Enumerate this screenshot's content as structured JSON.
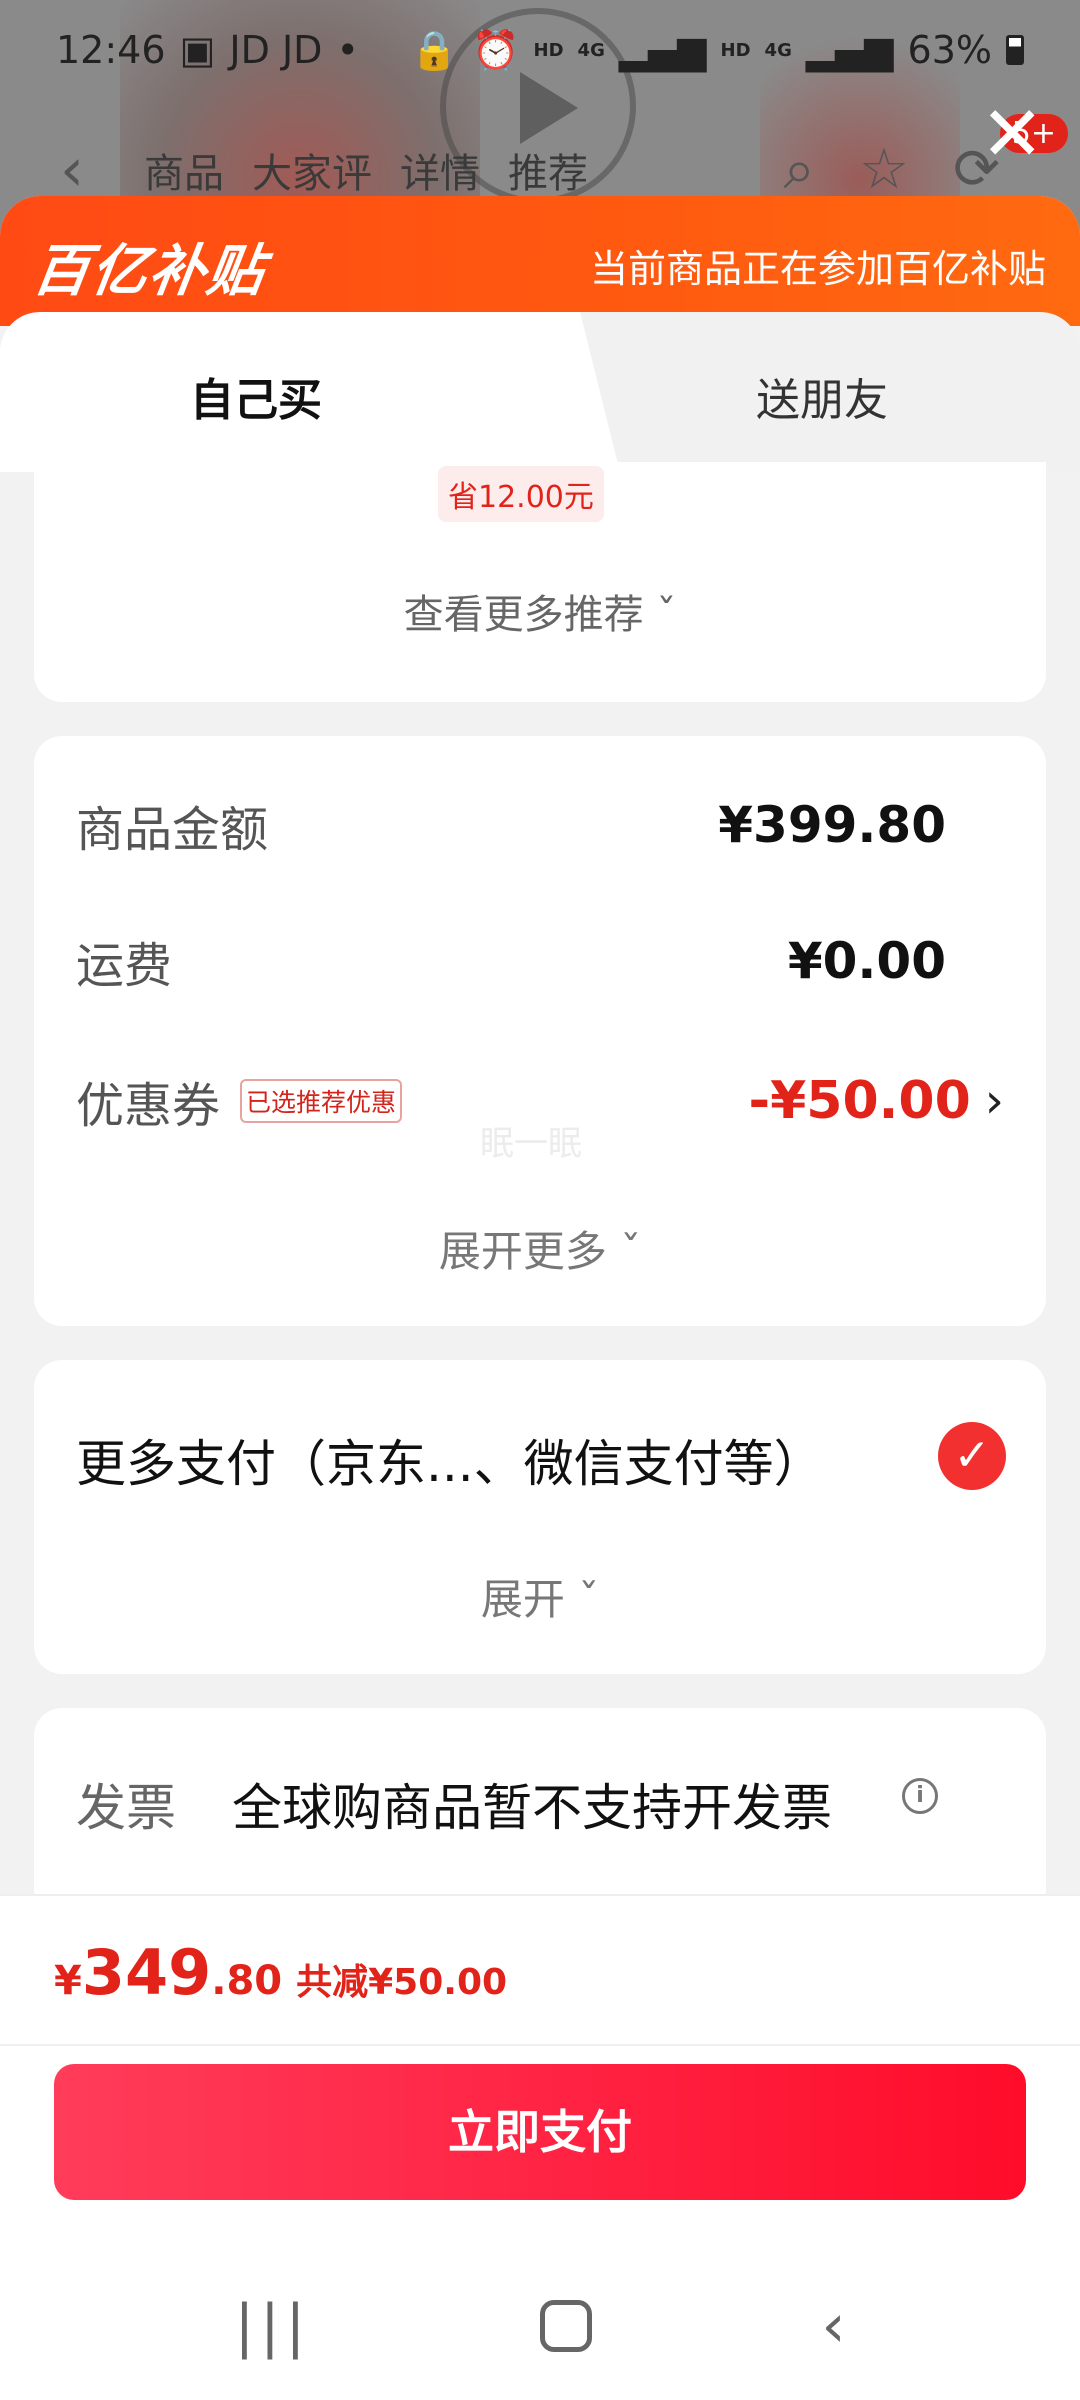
{
  "status": {
    "time": "12:46",
    "apps": "JD JD",
    "dot": "•",
    "net1": "HD",
    "net2": "4G",
    "net3": "HD",
    "net4": "4G",
    "battery": "63%"
  },
  "background_nav": {
    "tabs": [
      "商品",
      "大家评",
      "详情",
      "推荐"
    ],
    "badge": "5+"
  },
  "banner": {
    "logo": "百亿补贴",
    "note": "当前商品正在参加百亿补贴"
  },
  "tabs": {
    "mine": "自己买",
    "gift": "送朋友"
  },
  "recommend": {
    "save_tag": "省12.00元",
    "more": "查看更多推荐"
  },
  "amount": {
    "goods_label": "商品金额",
    "goods_value": "¥399.80",
    "shipping_label": "运费",
    "shipping_value": "¥0.00",
    "coupon_label": "优惠券",
    "coupon_tag": "已选推荐优惠",
    "coupon_value": "-¥50.00",
    "watermark": "眠一眠",
    "expand_more": "展开更多"
  },
  "payment": {
    "label": "更多支付（京东...、微信支付等）",
    "expand": "展开"
  },
  "invoice": {
    "label": "发票",
    "text": "全球购商品暂不支持开发票"
  },
  "bottom": {
    "yen": "¥",
    "price_int": "349",
    "price_dec": ".80",
    "total_save": "共减¥50.00",
    "pay_button": "立即支付"
  },
  "colors": {
    "accent": "#e2231a",
    "banner": "#ff5214",
    "pay_button": "#ff2444"
  }
}
